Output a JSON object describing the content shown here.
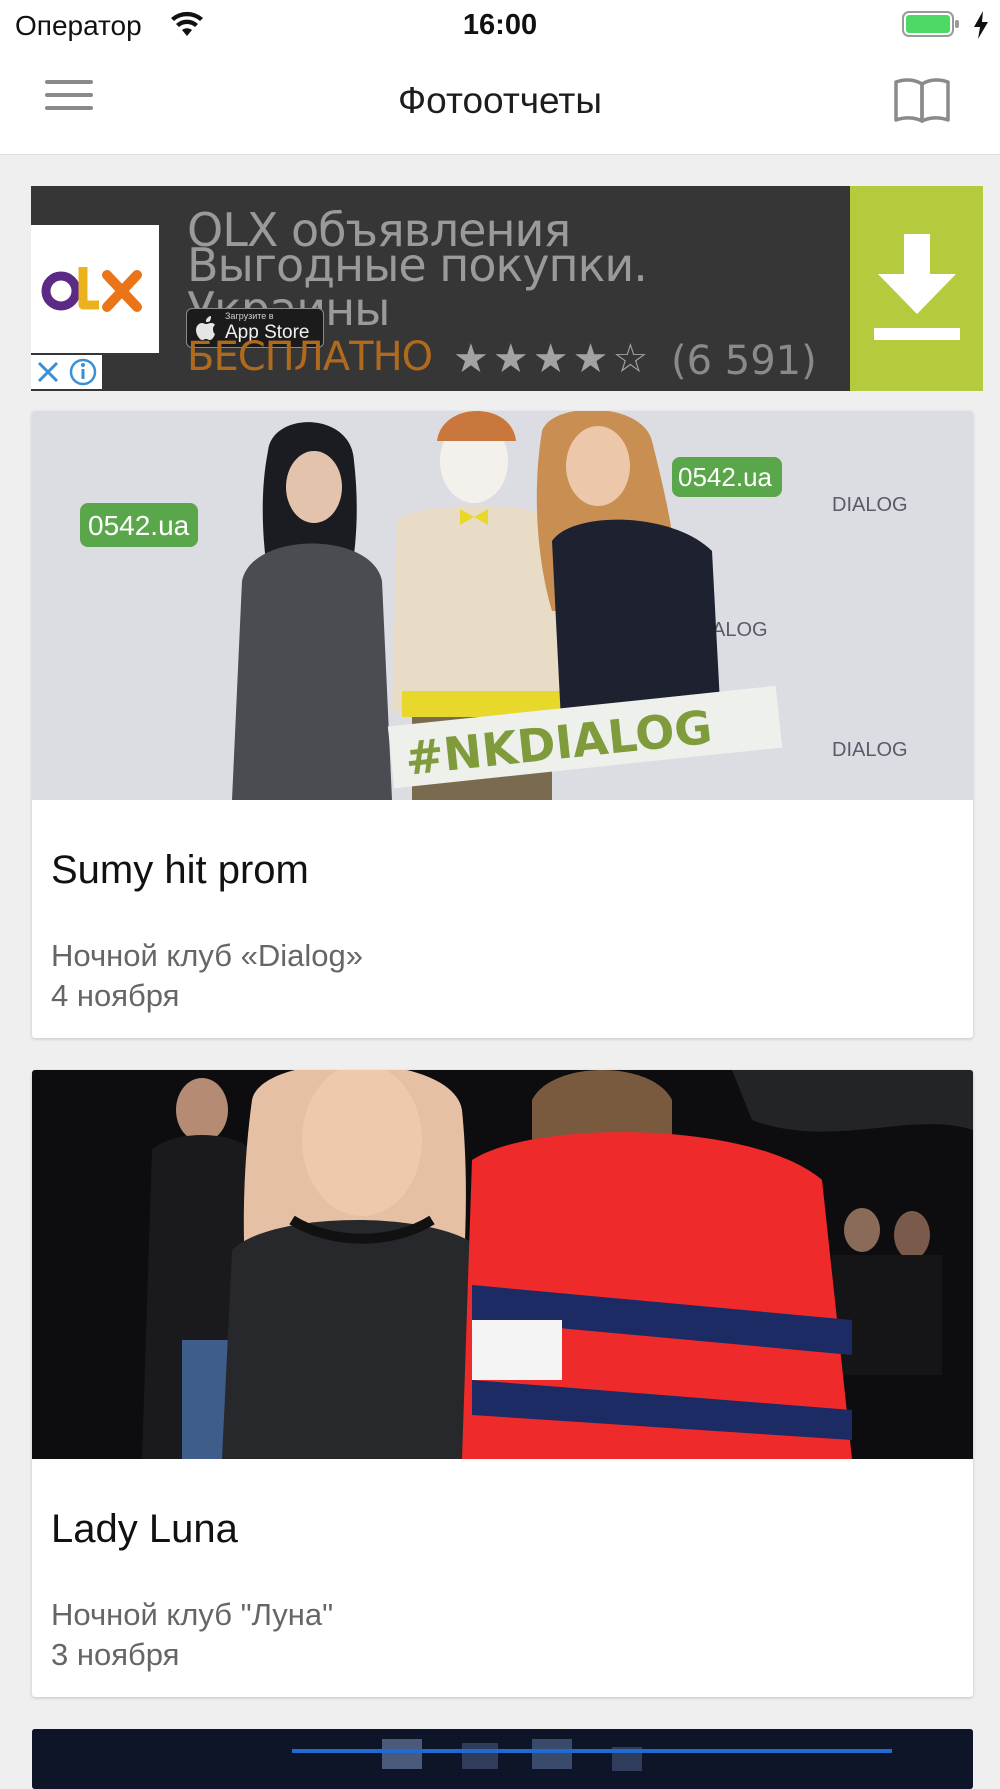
{
  "status_bar": {
    "carrier": "Оператор",
    "time": "16:00",
    "battery_color": "#4cd964"
  },
  "nav": {
    "title": "Фотоотчеты",
    "menu_icon": "hamburger-menu-icon",
    "book_icon": "book-icon"
  },
  "ad": {
    "brand_logo": "OLX",
    "title": "OLX объявления",
    "subtitle": "Выгодные покупки. Украины",
    "badge_small": "Загрузите в",
    "badge_big": "App Store",
    "price": "БЕСПЛАТНО",
    "stars": "★★★★☆",
    "rating_count": "(6 591)",
    "download_color": "#b6ca3d",
    "price_color": "#b06a1e"
  },
  "reports": [
    {
      "title": "Sumy hit prom",
      "venue": "Ночной клуб «Dialog»",
      "date": "4 ноября",
      "photo_banner": "#NKDIALOG",
      "photo_logo": "0542.ua",
      "photo_brand": "DIALOG"
    },
    {
      "title": "Lady Luna",
      "venue": "Ночной клуб \"Луна\"",
      "date": "3 ноября"
    }
  ]
}
